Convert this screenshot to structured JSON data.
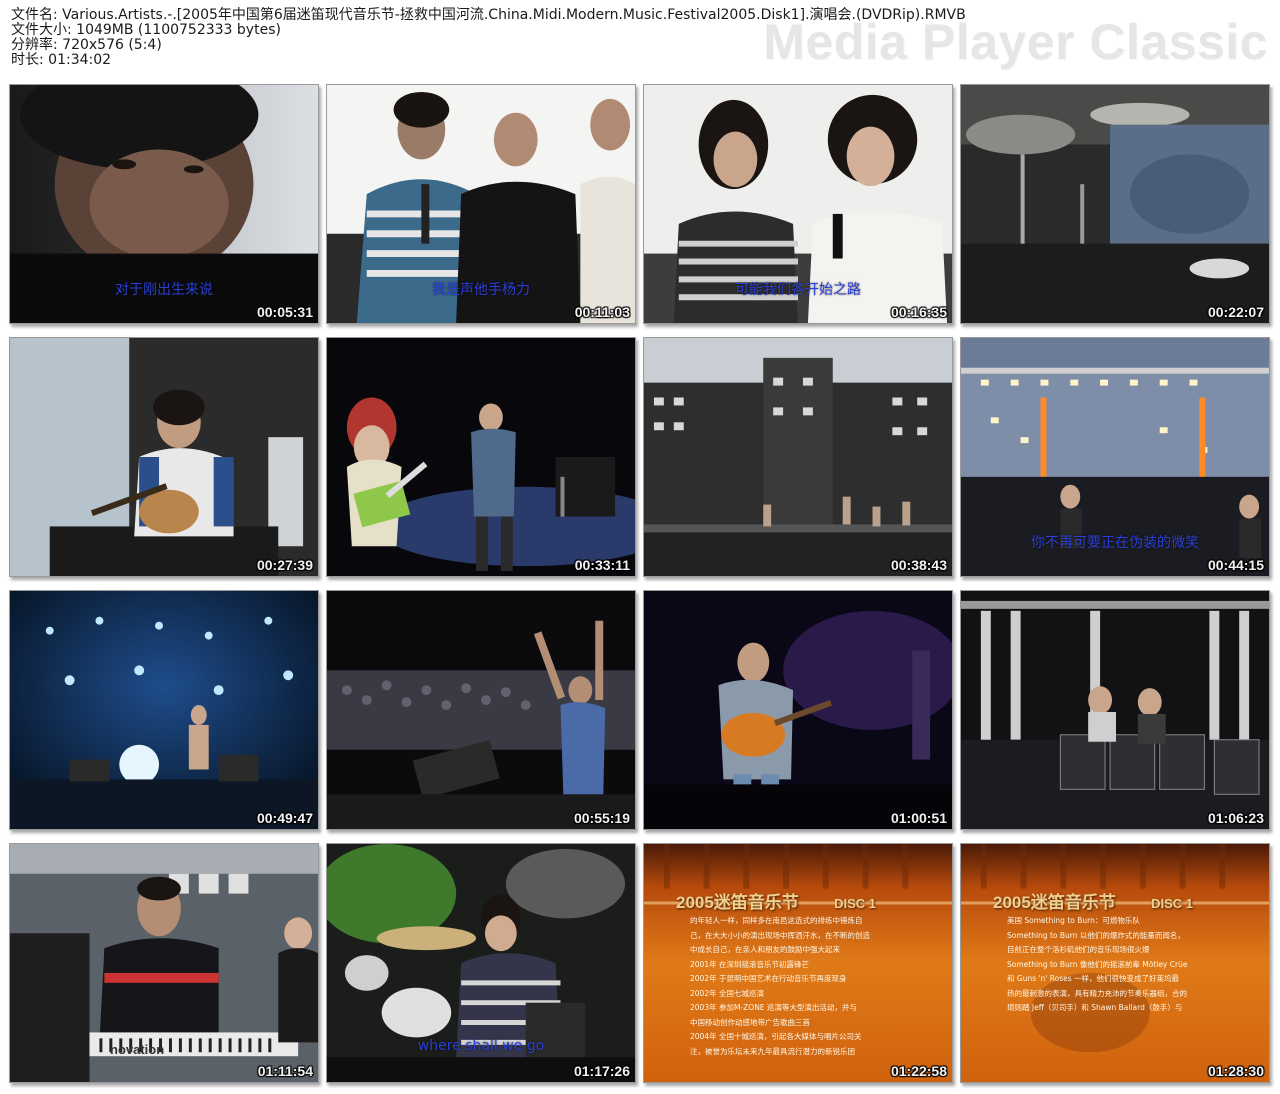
{
  "header": {
    "file_name": "文件名: Various.Artists.-.[2005年中国第6届迷笛现代音乐节-拯救中国河流.China.Midi.Modern.Music.Festival2005.Disk1].演唱会.(DVDRip).RMVB",
    "file_size": "文件大小: 1049MB (1100752333 bytes)",
    "resolution": "分辨率: 720x576 (5:4)",
    "duration": "时长: 01:34:02"
  },
  "brand": "Media Player Classic",
  "colors": {
    "subtitle": "#2a3fd6",
    "timecode": "#f2f2f2",
    "orange_card": "#d86b12"
  },
  "thumbnails": [
    {
      "time": "00:05:31",
      "subtitle": "对于刚出生来说",
      "scene": "closeup-face"
    },
    {
      "time": "00:11:03",
      "subtitle": "我是声他手杨力",
      "scene": "interview-group"
    },
    {
      "time": "00:16:35",
      "subtitle": "可能我们各开始之路",
      "scene": "interview-women"
    },
    {
      "time": "00:22:07",
      "subtitle": "",
      "scene": "drummer-closeup"
    },
    {
      "time": "00:27:39",
      "subtitle": "",
      "scene": "singer-guitar"
    },
    {
      "time": "00:33:11",
      "subtitle": "",
      "scene": "guitarist-stage"
    },
    {
      "time": "00:38:43",
      "subtitle": "",
      "scene": "stage-wide-day"
    },
    {
      "time": "00:44:15",
      "subtitle": "你不再可要正在伪装的微笑",
      "scene": "stage-lights-dusk"
    },
    {
      "time": "00:49:47",
      "subtitle": "",
      "scene": "stage-blue-lights"
    },
    {
      "time": "00:55:19",
      "subtitle": "",
      "scene": "crowd-arms"
    },
    {
      "time": "01:00:51",
      "subtitle": "",
      "scene": "guitarist-dark"
    },
    {
      "time": "01:06:23",
      "subtitle": "",
      "scene": "stage-night-band"
    },
    {
      "time": "01:11:54",
      "subtitle": "",
      "scene": "keyboardist",
      "keyboard_brand": "novation"
    },
    {
      "time": "01:17:26",
      "subtitle": "where shall we go",
      "scene": "drummer-girl"
    },
    {
      "time": "01:22:58",
      "subtitle": "",
      "scene": "orange-card-1",
      "card_title": "2005迷笛音乐节",
      "card_badge": "DISC 1",
      "card_lines": [
        "的年轻人一样，同样多在南邑这选式的排练中锤炼自",
        "己，在大大小小的演出现场中挥洒汗水，在不断的创造",
        "中成长自己，在亲人和朋友的鼓励中强大起来",
        "2001年    在深圳摇滚音乐节初露锋芒",
        "2002年    于昆明中国艺术在行动音乐节再度现身",
        "2002年    全国七城巡演",
        "2003年    参加M-ZONE 巡演等大型演出活动，并与",
        "中国移动创作动感地带广告歌曲三首",
        "2004年    全国十城巡演，引起各大媒体与唱片公司关",
        "注，被誉为乐坛未来九年最具流行潜力的新锐乐团"
      ]
    },
    {
      "time": "01:28:30",
      "subtitle": "",
      "scene": "orange-card-2",
      "card_title": "2005迷笛音乐节",
      "card_badge": "DISC 1",
      "card_lines": [
        "美国 Something to Burn：可燃物乐队",
        "",
        "Something to Burn 以他们的爆炸式的能量而闻名，",
        "目前正在整个洛杉矶他们的音乐现场很火爆",
        "",
        "Something to Burn 像他们的摇滚前辈 Mötley Crüe",
        "和 Guns 'n' Roses 一样，他们很快变成了好莱坞最",
        "热的最刺激的表演，具有精力充沛的节奏乐器组，合的",
        "琐则踏 Jeff（贝司手）和 Shawn Ballard（鼓手）与"
      ]
    }
  ]
}
